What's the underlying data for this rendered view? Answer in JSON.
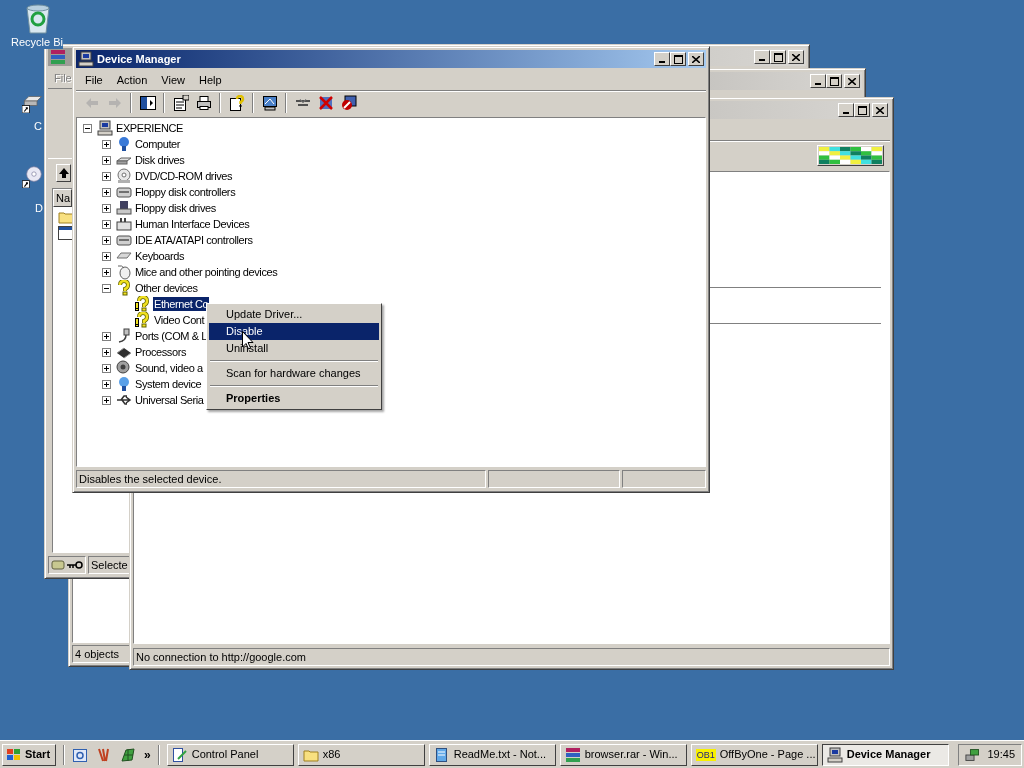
{
  "desktop": {
    "icons": [
      {
        "kind": "recycle_bin",
        "label": "Recycle Bi"
      },
      {
        "kind": "drive",
        "label": "C"
      },
      {
        "kind": "cd",
        "label": "D"
      }
    ]
  },
  "archive_window": {
    "menu": [
      {
        "label": "File",
        "disabled": true
      }
    ],
    "column_header": "Na",
    "status": "Selecte"
  },
  "folder_window": {
    "status": "4 objects"
  },
  "browser_window": {
    "status": "No connection to http://google.com"
  },
  "device_manager": {
    "title": "Device Manager",
    "menu": [
      "File",
      "Action",
      "View",
      "Help"
    ],
    "toolbar_groups": [
      {
        "buttons": [
          {
            "kind": "back",
            "disabled": true
          },
          {
            "kind": "forward",
            "disabled": true
          }
        ]
      },
      {
        "buttons": [
          {
            "kind": "tree",
            "disabled": false
          }
        ]
      },
      {
        "buttons": [
          {
            "kind": "properties",
            "disabled": false
          },
          {
            "kind": "print",
            "disabled": false
          }
        ]
      },
      {
        "buttons": [
          {
            "kind": "help",
            "disabled": false
          }
        ]
      },
      {
        "buttons": [
          {
            "kind": "scan",
            "disabled": false
          }
        ]
      },
      {
        "buttons": [
          {
            "kind": "update",
            "disabled": false
          },
          {
            "kind": "uninstall",
            "disabled": false
          },
          {
            "kind": "disable",
            "disabled": false
          }
        ]
      }
    ],
    "tree": {
      "label": "EXPERIENCE",
      "kind": "computer",
      "expanded": true,
      "selected": false,
      "children": [
        {
          "label": "Computer",
          "kind": "monitor",
          "expanded": false,
          "selected": false
        },
        {
          "label": "Disk drives",
          "kind": "drive",
          "expanded": false,
          "selected": false
        },
        {
          "label": "DVD/CD-ROM drives",
          "kind": "cdrom",
          "expanded": false,
          "selected": false
        },
        {
          "label": "Floppy disk controllers",
          "kind": "controller",
          "expanded": false,
          "selected": false
        },
        {
          "label": "Floppy disk drives",
          "kind": "floppy",
          "expanded": false,
          "selected": false
        },
        {
          "label": "Human Interface Devices",
          "kind": "hid",
          "expanded": false,
          "selected": false
        },
        {
          "label": "IDE ATA/ATAPI controllers",
          "kind": "controller",
          "expanded": false,
          "selected": false
        },
        {
          "label": "Keyboards",
          "kind": "keyboard",
          "expanded": false,
          "selected": false
        },
        {
          "label": "Mice and other pointing devices",
          "kind": "mouse",
          "expanded": false,
          "selected": false
        },
        {
          "label": "Other devices",
          "kind": "unknown",
          "expanded": true,
          "selected": false,
          "children": [
            {
              "label": "Ethernet Co",
              "kind": "warning",
              "selected": true
            },
            {
              "label": "Video Cont",
              "kind": "warning",
              "selected": false
            }
          ]
        },
        {
          "label": "Ports (COM & L",
          "kind": "port",
          "expanded": false,
          "selected": false
        },
        {
          "label": "Processors",
          "kind": "chip",
          "expanded": false,
          "selected": false
        },
        {
          "label": "Sound, video a",
          "kind": "speaker",
          "expanded": false,
          "selected": false
        },
        {
          "label": "System device",
          "kind": "system",
          "expanded": false,
          "selected": false
        },
        {
          "label": "Universal Seria",
          "kind": "usb",
          "expanded": false,
          "selected": false
        }
      ]
    },
    "context_menu": [
      {
        "kind": "item",
        "label": "Update Driver...",
        "selected": false,
        "default": false
      },
      {
        "kind": "item",
        "label": "Disable",
        "selected": true,
        "default": false
      },
      {
        "kind": "item",
        "label": "Uninstall",
        "selected": false,
        "default": false
      },
      {
        "kind": "separator"
      },
      {
        "kind": "item",
        "label": "Scan for hardware changes",
        "selected": false,
        "default": false
      },
      {
        "kind": "separator"
      },
      {
        "kind": "item",
        "label": "Properties",
        "selected": false,
        "default": true
      }
    ],
    "status_bar": {
      "text": "Disables the selected device."
    }
  },
  "taskbar": {
    "start": "Start",
    "quick_launch_more": "»",
    "tasks": [
      {
        "kind": "control_panel",
        "label": "Control Panel",
        "selected": false
      },
      {
        "kind": "folder",
        "label": "x86",
        "selected": false
      },
      {
        "kind": "notepad",
        "label": "ReadMe.txt - Not...",
        "selected": false
      },
      {
        "kind": "archive",
        "label": "browser.rar - Win...",
        "selected": false
      },
      {
        "kind": "browser",
        "icon_text": "OB1",
        "label": "OffByOne - Page ...",
        "selected": false
      },
      {
        "kind": "device_manager",
        "label": "Device Manager",
        "selected": true
      }
    ],
    "clock": "19:45"
  }
}
